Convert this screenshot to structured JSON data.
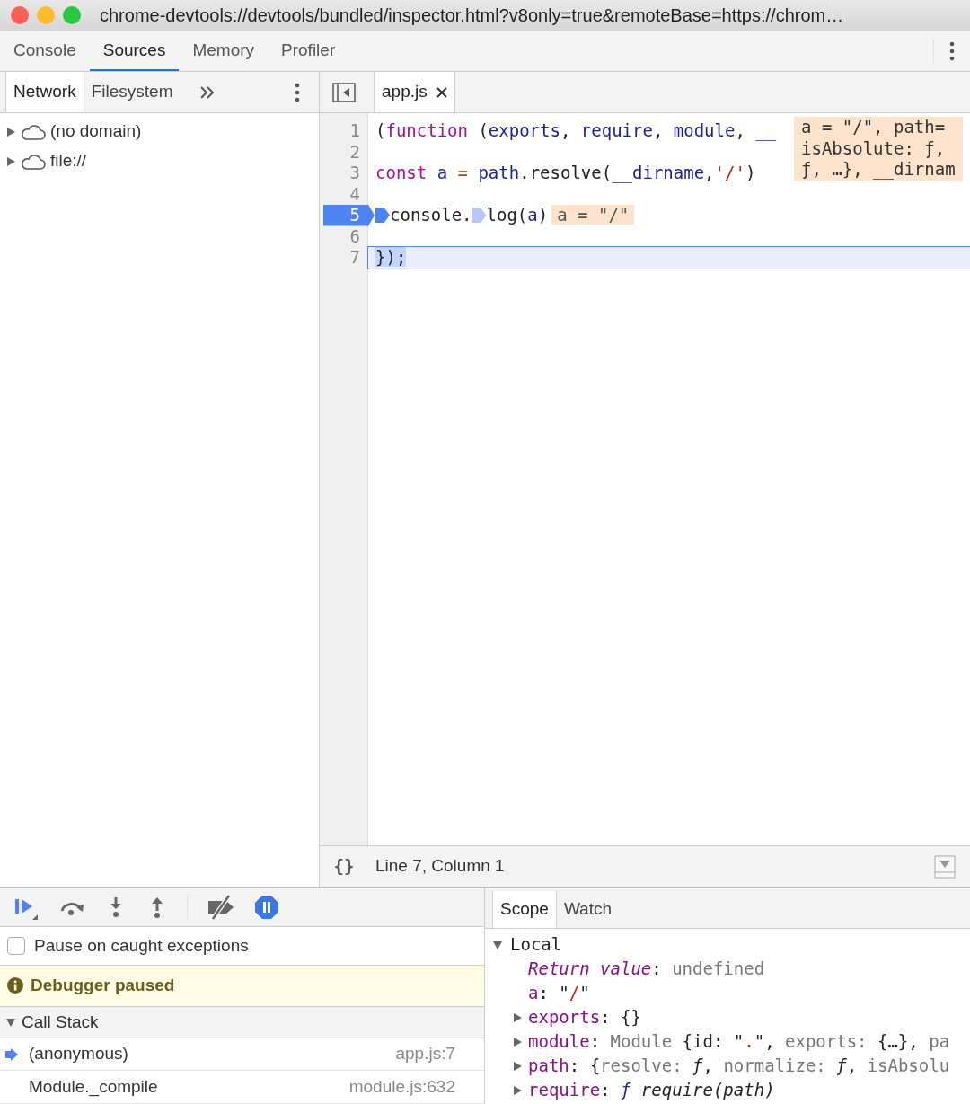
{
  "window": {
    "title": "chrome-devtools://devtools/bundled/inspector.html?v8only=true&remoteBase=https://chrom…"
  },
  "main_tabs": [
    {
      "label": "Console",
      "selected": false
    },
    {
      "label": "Sources",
      "selected": true
    },
    {
      "label": "Memory",
      "selected": false
    },
    {
      "label": "Profiler",
      "selected": false
    }
  ],
  "navigator": {
    "tabs": [
      {
        "label": "Network",
        "selected": true
      },
      {
        "label": "Filesystem",
        "selected": false
      }
    ],
    "tree": [
      {
        "label": "(no domain)",
        "expanded": false
      },
      {
        "label": "file://",
        "expanded": false
      }
    ]
  },
  "editor": {
    "tabs": [
      {
        "label": "app.js",
        "selected": true
      }
    ],
    "lines": [
      {
        "number": "1",
        "execution": false,
        "current": false,
        "tokens": [
          {
            "kind": "plain",
            "text": "("
          },
          {
            "kind": "keyword",
            "text": "function"
          },
          {
            "kind": "plain",
            "text": " ("
          },
          {
            "kind": "def",
            "text": "exports"
          },
          {
            "kind": "plain",
            "text": ", "
          },
          {
            "kind": "def",
            "text": "require"
          },
          {
            "kind": "plain",
            "text": ", "
          },
          {
            "kind": "def",
            "text": "module"
          },
          {
            "kind": "plain",
            "text": ", "
          },
          {
            "kind": "def",
            "text": "__"
          }
        ]
      },
      {
        "number": "2",
        "execution": false,
        "current": false
      },
      {
        "number": "3",
        "execution": false,
        "current": false,
        "tokens": [
          {
            "kind": "keyword",
            "text": "const "
          },
          {
            "kind": "def",
            "text": "a"
          },
          {
            "kind": "operator",
            "text": " = "
          },
          {
            "kind": "def",
            "text": "path"
          },
          {
            "kind": "plain",
            "text": ".resolve("
          },
          {
            "kind": "def",
            "text": "__dirname"
          },
          {
            "kind": "plain",
            "text": ","
          },
          {
            "kind": "string",
            "text": "'/'"
          },
          {
            "kind": "plain",
            "text": ")"
          }
        ]
      },
      {
        "number": "4",
        "execution": false,
        "current": false
      },
      {
        "number": "5",
        "execution": true,
        "current": false,
        "tokens": [
          {
            "kind": "marker",
            "active": true
          },
          {
            "kind": "plain",
            "text": "console."
          },
          {
            "kind": "marker",
            "active": false
          },
          {
            "kind": "plain",
            "text": "log("
          },
          {
            "kind": "def",
            "text": "a"
          },
          {
            "kind": "plain",
            "text": ")"
          }
        ],
        "inline_value": "a = \"/\""
      },
      {
        "number": "6",
        "execution": false,
        "current": false
      },
      {
        "number": "7",
        "execution": false,
        "current": true,
        "tokens": [
          {
            "kind": "plain",
            "text": "});"
          }
        ]
      }
    ],
    "popover": [
      "a = \"/\", path=",
      "isAbsolute: ƒ,",
      "ƒ, …}, __dirnam"
    ],
    "format_button": "{}",
    "status": "Line 7, Column 1"
  },
  "debugger": {
    "pause_on_caught": {
      "label": "Pause on caught exceptions",
      "checked": false
    },
    "message": "Debugger paused",
    "call_stack": {
      "title": "Call Stack",
      "expanded": true,
      "frames": [
        {
          "name": "(anonymous)",
          "location": "app.js:7",
          "selected": true
        },
        {
          "name": "Module._compile",
          "location": "module.js:632",
          "selected": false
        }
      ]
    }
  },
  "sidebar_tabs": [
    {
      "label": "Scope",
      "selected": true
    },
    {
      "label": "Watch",
      "selected": false
    }
  ],
  "scope": {
    "title": "Local",
    "expanded": true,
    "items": [
      {
        "expandable": false,
        "tokens": [
          {
            "kind": "special",
            "text": "Return value"
          },
          {
            "kind": "plain",
            "text": ": "
          },
          {
            "kind": "dim",
            "text": "undefined"
          }
        ]
      },
      {
        "expandable": false,
        "tokens": [
          {
            "kind": "name",
            "text": "a"
          },
          {
            "kind": "plain",
            "text": ": \""
          },
          {
            "kind": "string",
            "text": "/"
          },
          {
            "kind": "plain",
            "text": "\""
          }
        ]
      },
      {
        "expandable": true,
        "tokens": [
          {
            "kind": "name",
            "text": "exports"
          },
          {
            "kind": "plain",
            "text": ": {}"
          }
        ]
      },
      {
        "expandable": true,
        "tokens": [
          {
            "kind": "name",
            "text": "module"
          },
          {
            "kind": "plain",
            "text": ": "
          },
          {
            "kind": "dim",
            "text": "Module"
          },
          {
            "kind": "plain",
            "text": " {id: \""
          },
          {
            "kind": "string",
            "text": "."
          },
          {
            "kind": "plain",
            "text": "\", "
          },
          {
            "kind": "dim",
            "text": "exports: "
          },
          {
            "kind": "plain",
            "text": "{…}, "
          },
          {
            "kind": "dim",
            "text": "pa"
          }
        ]
      },
      {
        "expandable": true,
        "tokens": [
          {
            "kind": "name",
            "text": "path"
          },
          {
            "kind": "plain",
            "text": ": {"
          },
          {
            "kind": "dim",
            "text": "resolve: "
          },
          {
            "kind": "italic",
            "text": "ƒ"
          },
          {
            "kind": "plain",
            "text": ", "
          },
          {
            "kind": "dim",
            "text": "normalize: "
          },
          {
            "kind": "italic",
            "text": "ƒ"
          },
          {
            "kind": "plain",
            "text": ", "
          },
          {
            "kind": "dim",
            "text": "isAbsolu"
          }
        ]
      },
      {
        "expandable": true,
        "tokens": [
          {
            "kind": "name",
            "text": "require"
          },
          {
            "kind": "plain",
            "text": ": "
          },
          {
            "kind": "fn",
            "text": "ƒ "
          },
          {
            "kind": "italic",
            "text": "require(path)"
          }
        ]
      }
    ]
  }
}
